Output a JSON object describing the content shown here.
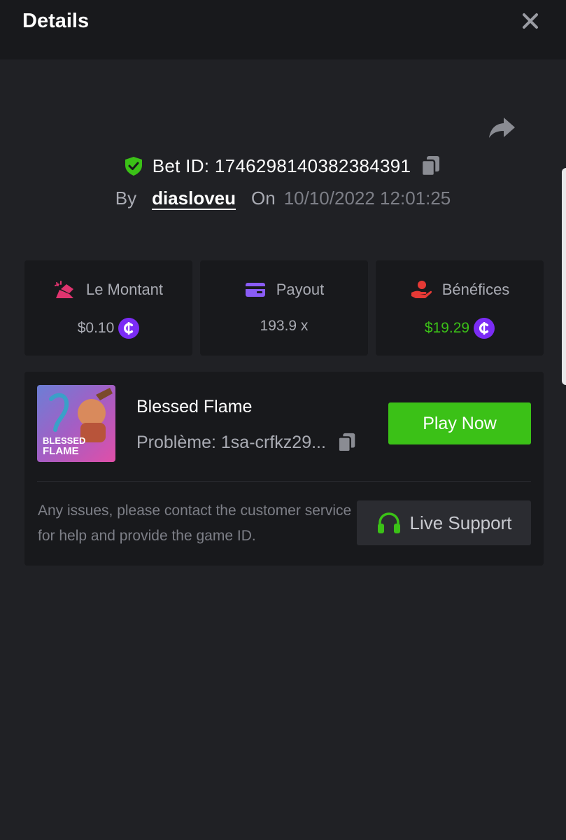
{
  "header": {
    "title": "Details",
    "close_icon": "close-icon"
  },
  "bet": {
    "id_label": "Bet ID: 1746298140382384391",
    "by_label": "By",
    "username": "diasloveu",
    "on_label": "On",
    "datetime": "10/10/2022 12:01:25"
  },
  "stats": [
    {
      "label": "Le Montant",
      "value": "$0.10",
      "icon": "bet-amount-icon",
      "color": "#e0346f"
    },
    {
      "label": "Payout",
      "value": "193.9 x",
      "icon": "card-icon",
      "color": "#8a5cf5"
    },
    {
      "label": "Bénéfices",
      "value": "$19.29",
      "icon": "profit-hand-icon",
      "color": "#e53935"
    }
  ],
  "game": {
    "name": "Blessed Flame",
    "probleme": "Problème: 1sa-crfkz29...",
    "thumb_title_line1": "BLESSED",
    "thumb_title_line2": "FLAME",
    "play_label": "Play Now"
  },
  "support": {
    "text": "Any issues, please contact the customer service for help and provide the game ID.",
    "button_label": "Live Support"
  },
  "colors": {
    "accent_green": "#3bc117",
    "coin_purple": "#7b2cf5",
    "background": "#202125",
    "card": "#18191c"
  }
}
